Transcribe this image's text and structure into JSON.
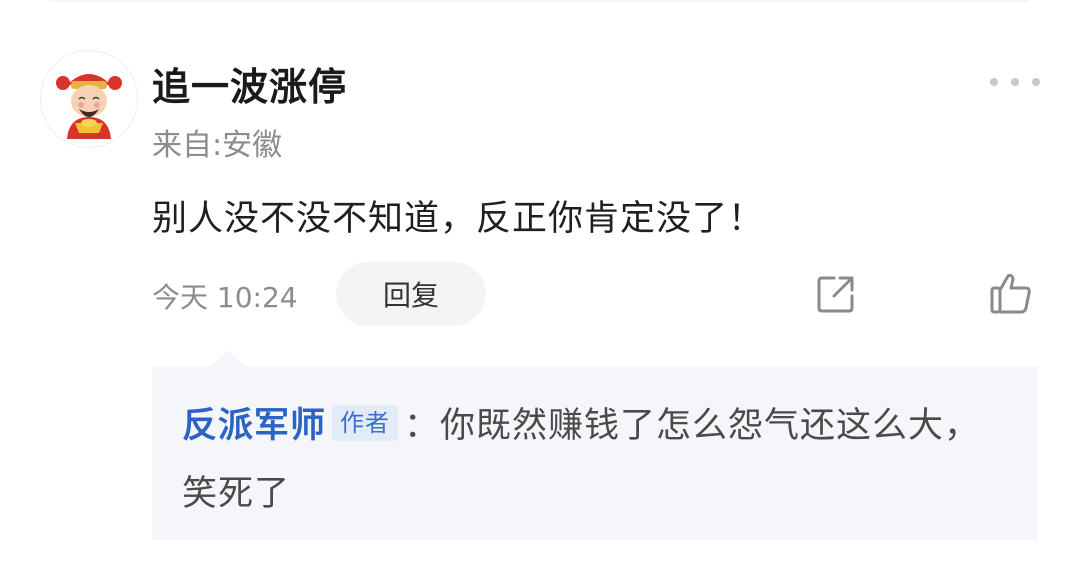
{
  "comment": {
    "username": "追一波涨停",
    "location": "来自:安徽",
    "content": "别人没不没不知道，反正你肯定没了！",
    "time": "今天 10:24",
    "reply_label": "回复"
  },
  "reply": {
    "author": "反派军师",
    "author_tag": "作者",
    "separator": "：",
    "content": "你既然赚钱了怎么怨气还这么大，笑死了"
  },
  "icons": {
    "avatar": "cartoon-god-of-wealth-avatar",
    "more": "more-dots-icon",
    "share": "share-icon",
    "like": "thumbs-up-icon"
  },
  "colors": {
    "author_blue": "#2b62c6",
    "tag_bg": "#e3ebf8",
    "reply_bg": "#f4f6f9"
  }
}
